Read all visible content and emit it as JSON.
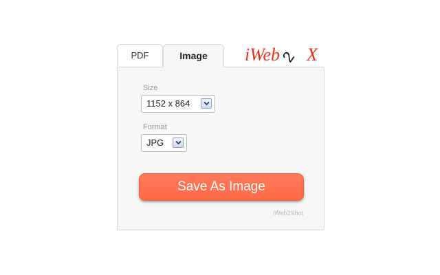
{
  "tabs": [
    {
      "label": "PDF",
      "active": false
    },
    {
      "label": "Image",
      "active": true
    }
  ],
  "logo": {
    "text_left": "iWeb",
    "text_middle": "2",
    "text_right": "X",
    "color_red": "#e8321e",
    "color_black": "#111111"
  },
  "form": {
    "size_label": "Size",
    "size_value": "1152 x 864",
    "format_label": "Format",
    "format_value": "JPG"
  },
  "save_button": {
    "label": "Save As Image",
    "color": "#ff6f4f"
  },
  "credit": "iWeb2Shot",
  "icons": {
    "dropdown": "chevron-down-icon"
  }
}
